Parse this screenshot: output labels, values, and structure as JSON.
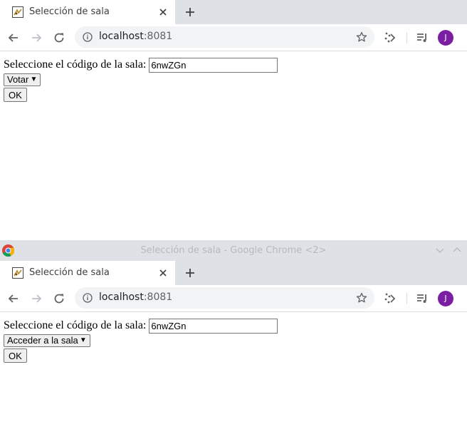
{
  "windows": [
    {
      "titlebar": null,
      "tab": {
        "title": "Selección de sala"
      },
      "omnibox": {
        "host": "localhost",
        "port": ":8081"
      },
      "avatar": {
        "letter": "J",
        "color": "#7b1fa2"
      },
      "form": {
        "label": "Seleccione el código de la sala:",
        "code_value": "6nwZGn",
        "selected_option": "Votar",
        "ok_label": "OK"
      }
    },
    {
      "titlebar": {
        "title": "Selección de sala - Google Chrome <2>"
      },
      "tab": {
        "title": "Selección de sala"
      },
      "omnibox": {
        "host": "localhost",
        "port": ":8081"
      },
      "avatar": {
        "letter": "J",
        "color": "#7b1fa2"
      },
      "form": {
        "label": "Seleccione el código de la sala:",
        "code_value": "6nwZGn",
        "selected_option": "Acceder a la sala",
        "ok_label": "OK"
      }
    }
  ],
  "icons": {
    "back": "back-arrow-icon",
    "forward": "forward-arrow-icon",
    "reload": "reload-icon",
    "info": "info-icon",
    "star": "bookmark-star-icon",
    "cast": "cast-icon",
    "media": "media-queue-icon",
    "close": "close-icon",
    "newtab": "plus-icon"
  }
}
